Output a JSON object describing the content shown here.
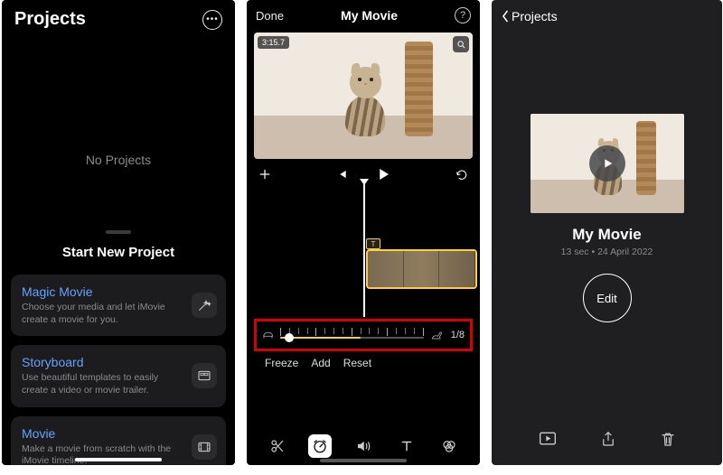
{
  "panel1": {
    "title": "Projects",
    "empty_label": "No Projects",
    "start_header": "Start New Project",
    "options": [
      {
        "title": "Magic Movie",
        "desc": "Choose your media and let iMovie create a movie for you.",
        "icon": "wand-icon"
      },
      {
        "title": "Storyboard",
        "desc": "Use beautiful templates to easily create a video or movie trailer.",
        "icon": "storyboard-icon"
      },
      {
        "title": "Movie",
        "desc": "Make a movie from scratch with the iMovie timeline.",
        "icon": "film-icon"
      }
    ]
  },
  "panel2": {
    "done": "Done",
    "title": "My Movie",
    "time_badge": "3:15.7",
    "speed_value": "1/8",
    "speed_fill_pct": 56,
    "speed_knob_pct": 6,
    "buttons": {
      "freeze": "Freeze",
      "add": "Add",
      "reset": "Reset"
    },
    "toolbar_selected": "speed"
  },
  "panel3": {
    "back": "Projects",
    "movie_name": "My Movie",
    "movie_sub": "13 sec • 24 April 2022",
    "edit_label": "Edit"
  }
}
